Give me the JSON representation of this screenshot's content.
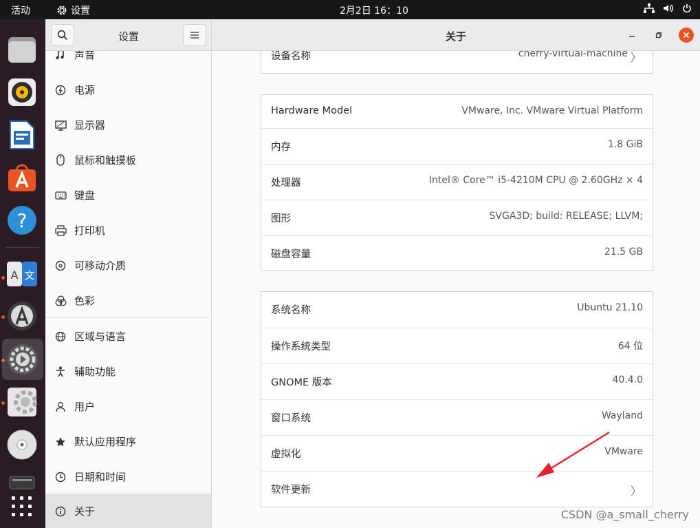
{
  "topbar": {
    "activities": "活动",
    "app_name": "设置",
    "clock": "2月2日  16：10"
  },
  "sidebar": {
    "title": "设置",
    "items": [
      {
        "label": "声音",
        "icon": "music-note-icon"
      },
      {
        "label": "电源",
        "icon": "power-icon"
      },
      {
        "label": "显示器",
        "icon": "display-icon"
      },
      {
        "label": "鼠标和触摸板",
        "icon": "mouse-icon"
      },
      {
        "label": "键盘",
        "icon": "keyboard-icon"
      },
      {
        "label": "打印机",
        "icon": "printer-icon"
      },
      {
        "label": "可移动介质",
        "icon": "removable-media-icon"
      },
      {
        "label": "色彩",
        "icon": "color-icon"
      },
      {
        "label": "区域与语言",
        "icon": "globe-icon"
      },
      {
        "label": "辅助功能",
        "icon": "accessibility-icon"
      },
      {
        "label": "用户",
        "icon": "users-icon"
      },
      {
        "label": "默认应用程序",
        "icon": "star-icon"
      },
      {
        "label": "日期和时间",
        "icon": "clock-icon"
      },
      {
        "label": "关于",
        "icon": "info-icon"
      }
    ]
  },
  "main": {
    "title": "关于",
    "device": {
      "key": "设备名称",
      "value": "cherry-virtual-machine"
    },
    "hardware": [
      {
        "key": "Hardware Model",
        "value": "VMware, Inc. VMware Virtual Platform"
      },
      {
        "key": "内存",
        "value": "1.8 GiB"
      },
      {
        "key": "处理器",
        "value": "Intel® Core™ i5-4210M CPU @ 2.60GHz × 4"
      },
      {
        "key": "图形",
        "value": "SVGA3D; build: RELEASE; LLVM;"
      },
      {
        "key": "磁盘容量",
        "value": "21.5 GB"
      }
    ],
    "system": [
      {
        "key": "系统名称",
        "value": "Ubuntu 21.10"
      },
      {
        "key": "操作系统类型",
        "value": "64 位"
      },
      {
        "key": "GNOME 版本",
        "value": "40.4.0"
      },
      {
        "key": "窗口系统",
        "value": "Wayland"
      },
      {
        "key": "虚拟化",
        "value": "VMware"
      },
      {
        "key": "软件更新",
        "value": ""
      }
    ]
  },
  "watermark": "CSDN @a_small_cherry",
  "colors": {
    "accent": "#e95420",
    "dock": "#2a1b25",
    "topbar": "#171717"
  }
}
